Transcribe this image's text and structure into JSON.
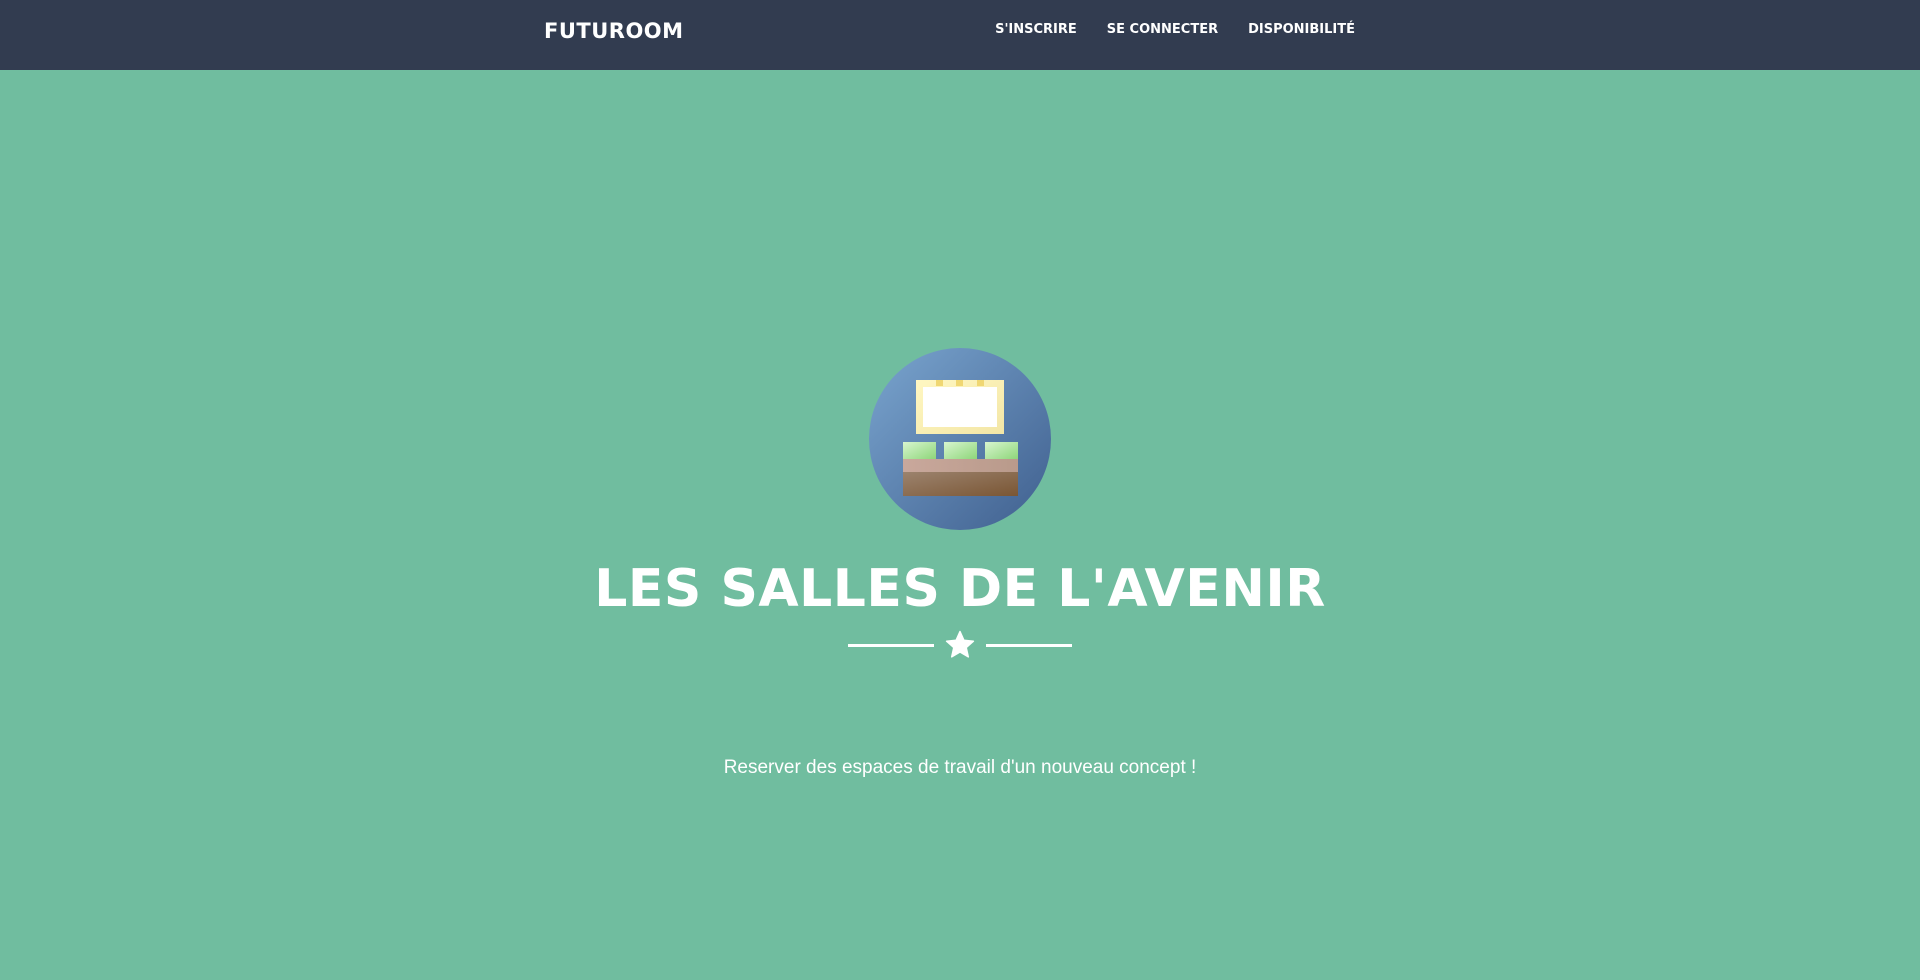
{
  "navbar": {
    "brand": "FUTUROOM",
    "links": [
      {
        "label": "S'INSCRIRE"
      },
      {
        "label": "SE CONNECTER"
      },
      {
        "label": "DISPONIBILITÉ"
      }
    ]
  },
  "hero": {
    "icon": "meeting-room-icon",
    "title": "LES SALLES DE L'AVENIR",
    "divider_icon": "star-icon",
    "subtitle": "Reserver des espaces de travail d'un nouveau concept !"
  },
  "colors": {
    "navbar_bg": "#323c50",
    "hero_bg": "#70bd9f",
    "text": "#ffffff",
    "icon_circle_light": "#7aa5cf",
    "icon_circle_dark": "#3f5f8e"
  }
}
